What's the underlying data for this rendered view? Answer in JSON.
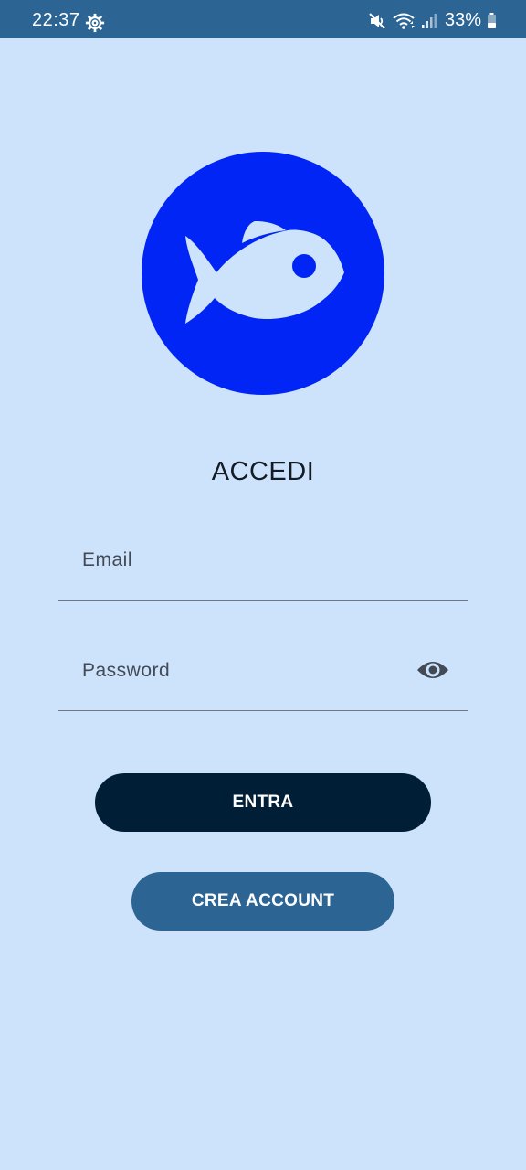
{
  "status_bar": {
    "time": "22:37",
    "battery": "33%",
    "icons": [
      "settings-gear-icon",
      "mute-icon",
      "wifi-icon",
      "signal-icon",
      "battery-icon"
    ]
  },
  "logo": {
    "icon": "fish-icon",
    "circle_color": "#0025f5",
    "fish_color": "#cde3fb"
  },
  "title": "ACCEDI",
  "form": {
    "email_label": "Email",
    "password_label": "Password",
    "password_toggle_icon": "eye-icon"
  },
  "buttons": {
    "login_label": "ENTRA",
    "register_label": "CREA ACCOUNT"
  },
  "colors": {
    "background": "#cde3fb",
    "status_bar": "#2c6594",
    "primary_button": "#001e36",
    "secondary_button": "#2c6594"
  }
}
